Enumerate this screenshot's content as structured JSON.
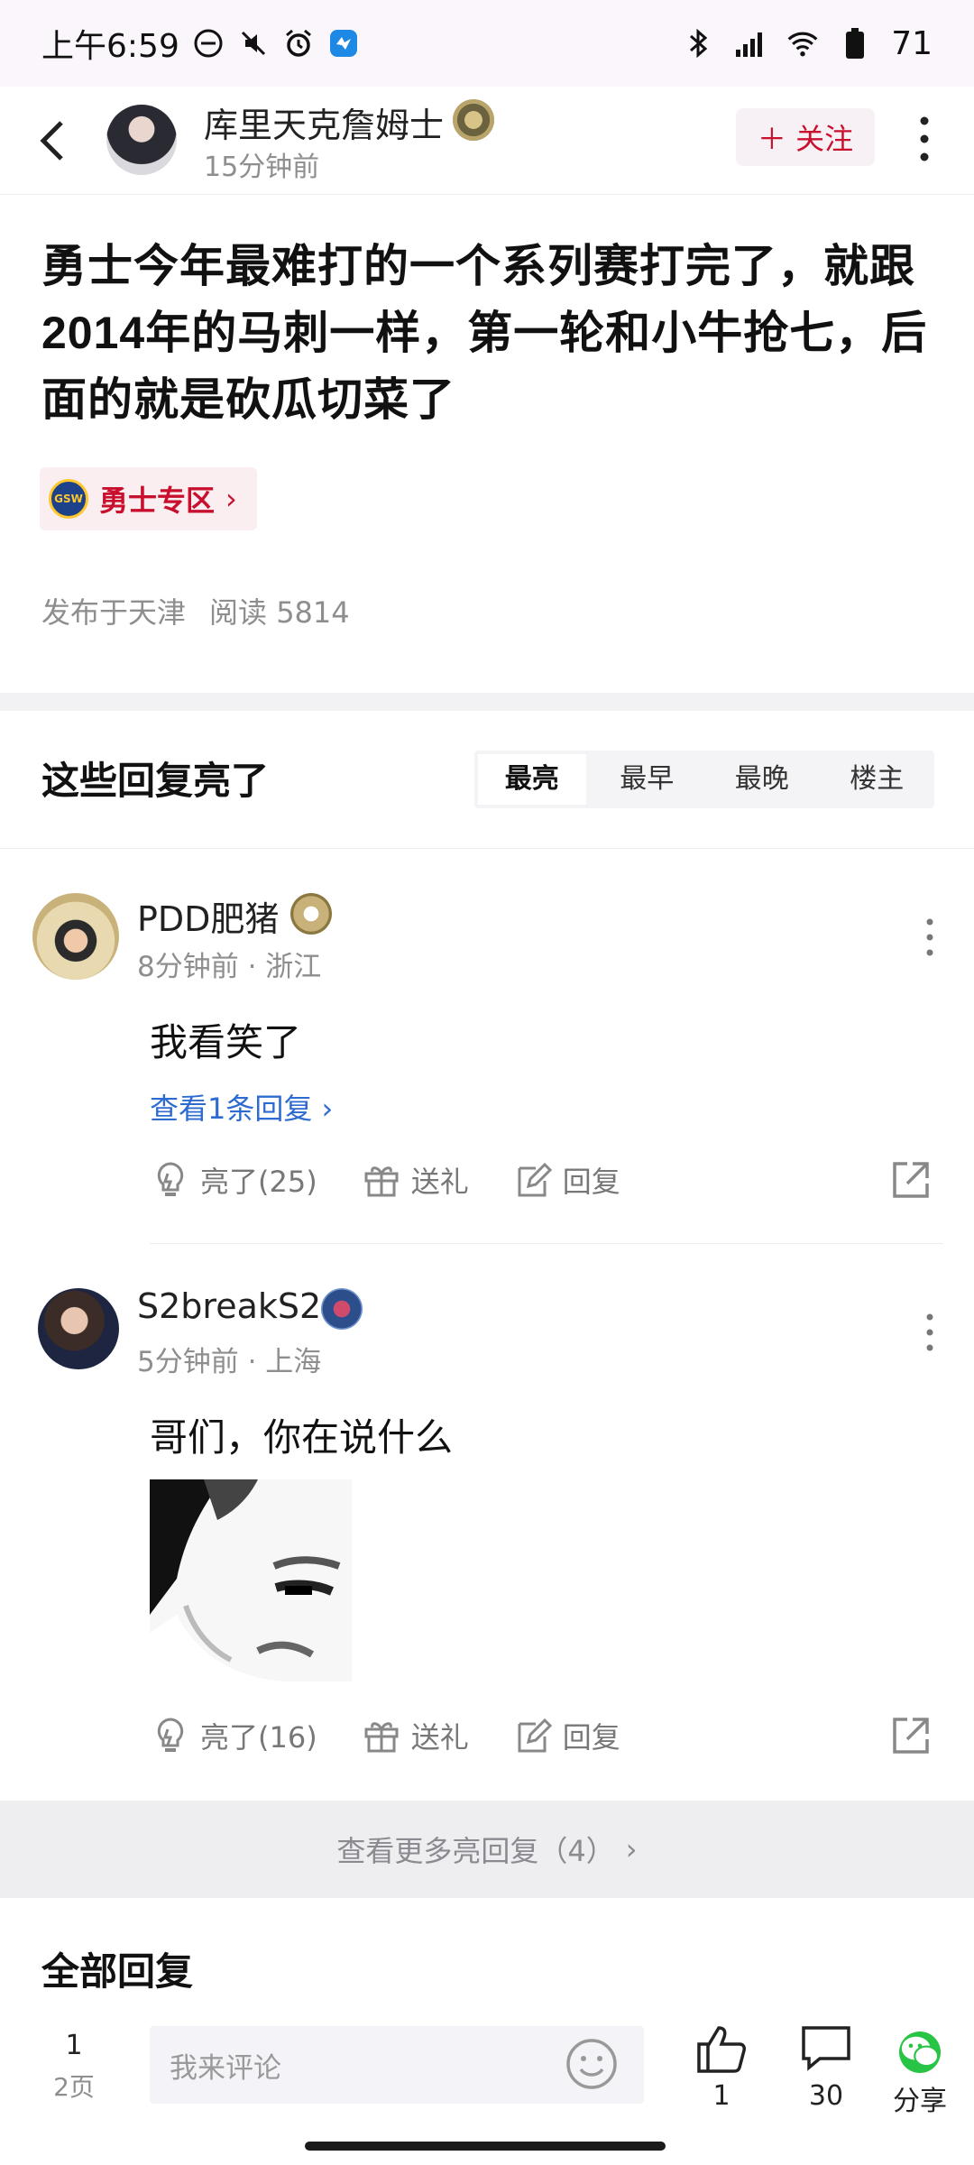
{
  "status_bar": {
    "time": "上午6:59",
    "battery": "71"
  },
  "header": {
    "author_name": "库里天克詹姆士",
    "post_time": "15分钟前",
    "follow_label": "＋ 关注"
  },
  "post": {
    "title_parts": [
      "勇士今年最难打的一个系列赛打完了，就跟",
      "2014",
      "年的马刺一样，第一轮和小牛抢七，后面的就是砍瓜切菜了"
    ],
    "zone_label": "勇士专区",
    "zone_logo_text": "GSW",
    "location": "发布于天津",
    "reads": "阅读 5814"
  },
  "bright_replies": {
    "title": "这些回复亮了",
    "sort_tabs": [
      "最亮",
      "最早",
      "最晚",
      "楼主"
    ],
    "active_tab": 0,
    "more_label": "查看更多亮回复（4）"
  },
  "comments": [
    {
      "name": "PDD肥猪",
      "meta": "8分钟前 · 浙江",
      "text": "我看笑了",
      "view_replies": "查看1条回复",
      "likes": "亮了(25)",
      "gift": "送礼",
      "reply": "回复"
    },
    {
      "name": "S2breakS2",
      "meta": "5分钟前 · 上海",
      "text": "哥们，你在说什么",
      "likes": "亮了(16)",
      "gift": "送礼",
      "reply": "回复"
    }
  ],
  "all_replies": {
    "title": "全部回复"
  },
  "bottom_bar": {
    "page_number": "1",
    "page_label": "2页",
    "input_placeholder": "我来评论",
    "like_count": "1",
    "comment_count": "30",
    "share_label": "分享"
  },
  "colors": {
    "accent_red": "#c8102e",
    "link_blue": "#2d6bd1",
    "wechat_green": "#28c445"
  }
}
